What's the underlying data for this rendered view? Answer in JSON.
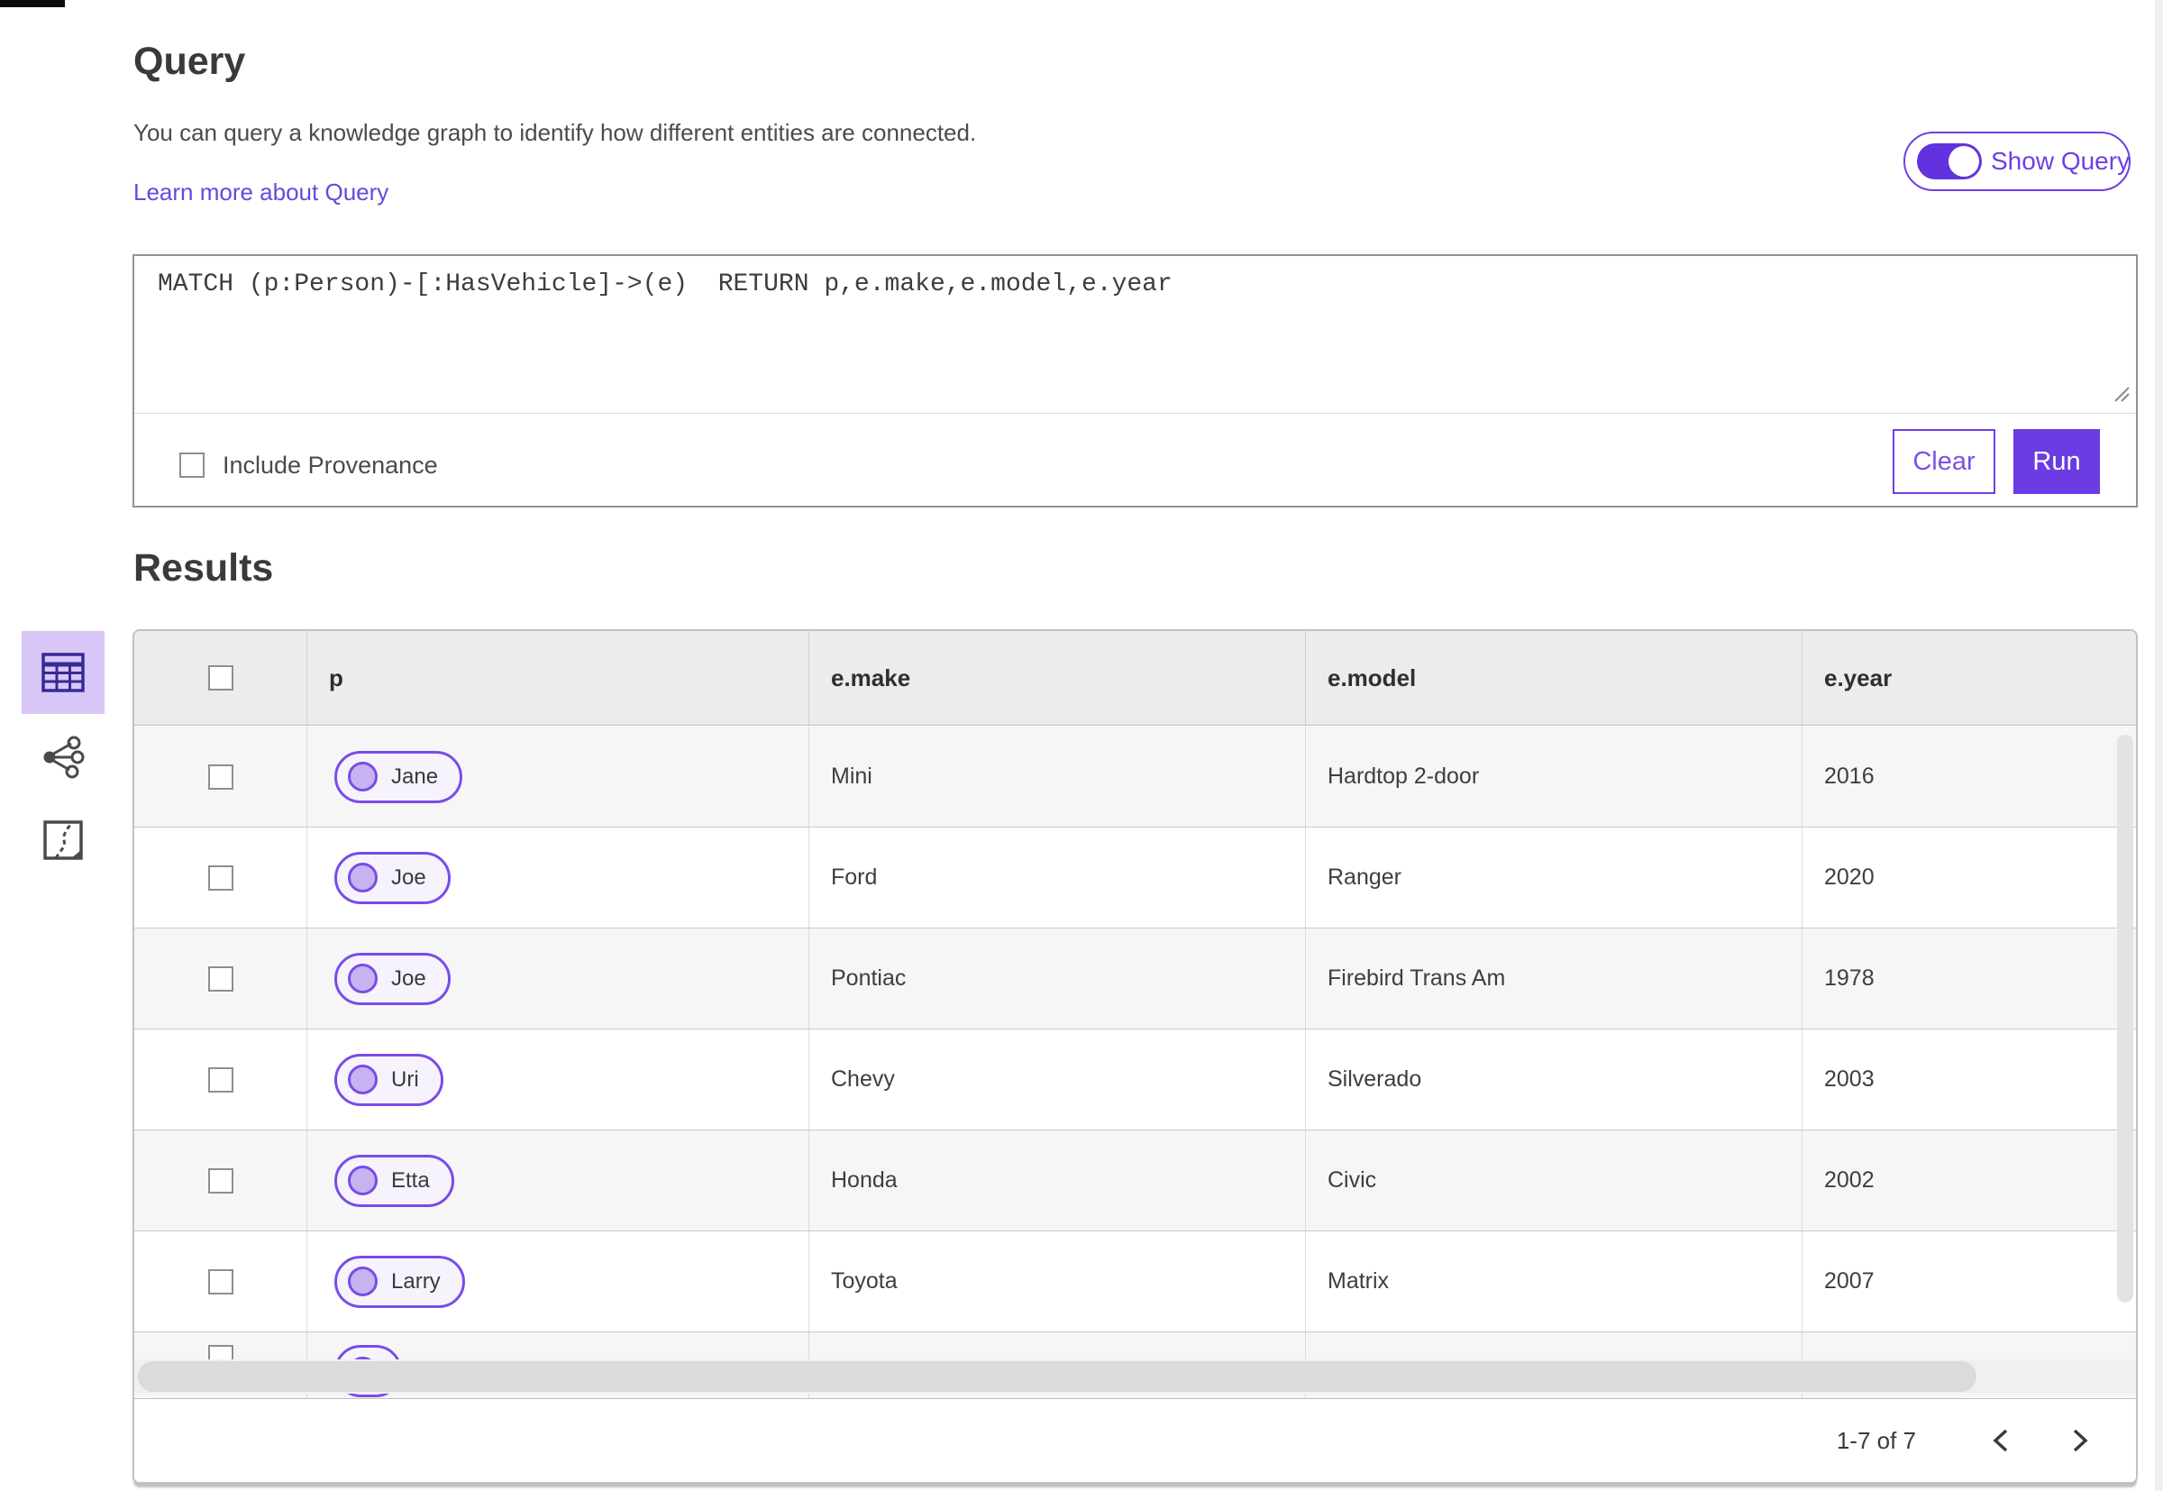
{
  "colors": {
    "accent_purple": "#6a3ce2",
    "accent_purple_border": "#6f3fe4",
    "selected_view_bg": "#d8c7f6",
    "selected_view_icon": "#372a96",
    "link_color": "#6847e2",
    "pill_border": "#7a4ce8",
    "pill_fill": "#f6f3fd",
    "pill_circle_fill": "#c6b4f0",
    "table_header_bg": "#ececec",
    "row_alt_bg": "#f6f6f7"
  },
  "query": {
    "title": "Query",
    "description": "You can query a knowledge graph to identify how different entities are connected.",
    "learn_more_label": "Learn more about Query",
    "show_query_label": "Show Query",
    "show_query_on": true,
    "text": "MATCH (p:Person)-[:HasVehicle]->(e)  RETURN p,e.make,e.model,e.year",
    "include_provenance_label": "Include Provenance",
    "include_provenance_checked": false,
    "clear_label": "Clear",
    "run_label": "Run"
  },
  "results": {
    "title": "Results",
    "views": {
      "selected": "table-view",
      "items": [
        "table-view",
        "link-chart-view",
        "map-view"
      ]
    },
    "table": {
      "headers": [
        "p",
        "e.make",
        "e.model",
        "e.year"
      ],
      "rows": [
        {
          "p": "Jane",
          "make": "Mini",
          "model": "Hardtop 2-door",
          "year": "2016"
        },
        {
          "p": "Joe",
          "make": "Ford",
          "model": "Ranger",
          "year": "2020"
        },
        {
          "p": "Joe",
          "make": "Pontiac",
          "model": "Firebird Trans Am",
          "year": "1978"
        },
        {
          "p": "Uri",
          "make": "Chevy",
          "model": "Silverado",
          "year": "2003"
        },
        {
          "p": "Etta",
          "make": "Honda",
          "model": "Civic",
          "year": "2002"
        },
        {
          "p": "Larry",
          "make": "Toyota",
          "model": "Matrix",
          "year": "2007"
        }
      ]
    },
    "pagination": {
      "range_label": "1-7 of 7"
    }
  }
}
